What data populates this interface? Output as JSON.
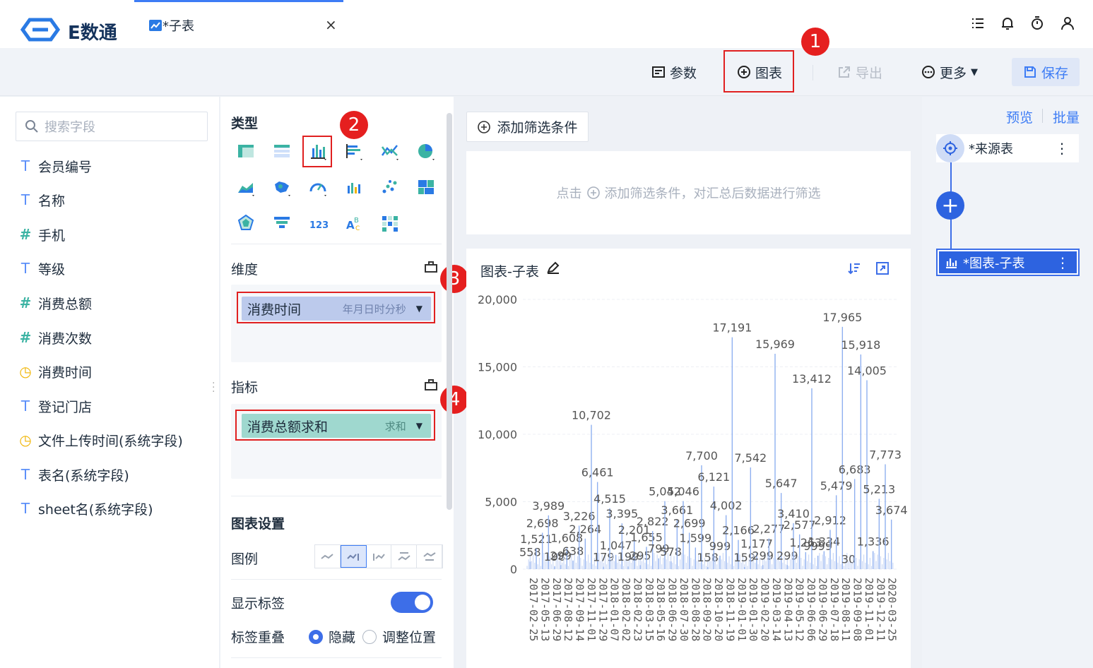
{
  "app": {
    "logo_text": "E数通"
  },
  "tab": {
    "title": "*子表",
    "close": "×"
  },
  "toolbar": {
    "params_label": "参数",
    "chart_label": "图表",
    "export_label": "导出",
    "more_label": "更多",
    "save_label": "保存"
  },
  "badges": [
    "1",
    "2",
    "3",
    "4"
  ],
  "search": {
    "placeholder": "搜索字段"
  },
  "fields": [
    {
      "type": "T",
      "label": "会员编号"
    },
    {
      "type": "T",
      "label": "名称"
    },
    {
      "type": "#",
      "label": "手机"
    },
    {
      "type": "T",
      "label": "等级"
    },
    {
      "type": "#",
      "label": "消费总额"
    },
    {
      "type": "#",
      "label": "消费次数"
    },
    {
      "type": "time",
      "label": "消费时间"
    },
    {
      "type": "T",
      "label": "登记门店"
    },
    {
      "type": "time",
      "label": "文件上传时间(系统字段)"
    },
    {
      "type": "T",
      "label": "表名(系统字段)"
    },
    {
      "type": "T",
      "label": "sheet名(系统字段)"
    }
  ],
  "config": {
    "type_title": "类型",
    "dimension_title": "维度",
    "dimension_pill": {
      "label": "消费时间",
      "sub": "年月日时分秒"
    },
    "metric_title": "指标",
    "metric_pill": {
      "label": "消费总额求和",
      "sub": "求和"
    },
    "chart_settings_title": "图表设置",
    "legend_label": "图例",
    "show_labels_label": "显示标签",
    "overlap_label": "标签重叠",
    "overlap_hide": "隐藏",
    "overlap_adjust": "调整位置"
  },
  "filter": {
    "add_label": "添加筛选条件",
    "hint_prefix": "点击",
    "hint_suffix": "添加筛选条件，对汇总后数据进行筛选"
  },
  "chart_card": {
    "title": "图表-子表"
  },
  "flow": {
    "preview": "预览",
    "batch": "批量",
    "source_node": "*来源表",
    "chart_node": "*图表-子表"
  },
  "colors": {
    "accent": "#3d6ee8",
    "bar": "#8fb0f0",
    "badge": "#e51f1f",
    "metric_pill": "#9fd8cf",
    "dimension_pill": "#bccaec"
  },
  "chart_data": {
    "type": "bar",
    "ylim": [
      0,
      20000
    ],
    "yticks": [
      "20,000",
      "15,000",
      "10,000",
      "5,000",
      "0"
    ],
    "xticks": [
      "2017-02-25",
      "2017-05-13",
      "2017-06-29",
      "2017-08-12",
      "2017-09-14",
      "2017-11-01",
      "2017-11-29",
      "2018-01-07",
      "2018-02-02",
      "2018-02-23",
      "2018-03-15",
      "2018-05-16",
      "2018-06-29",
      "2018-07-30",
      "2018-08-28",
      "2018-09-20",
      "2018-10-20",
      "2018-11-19",
      "2019-01-01",
      "2019-01-30",
      "2019-02-20",
      "2019-03-14",
      "2019-04-13",
      "2019-05-12",
      "2019-06-06",
      "2019-06-29",
      "2019-07-18",
      "2019-08-11",
      "2019-09-08",
      "2019-11-01",
      "2019-12-11",
      "2020-03-25"
    ],
    "labels": [
      "558",
      "1,521",
      "2,698",
      "3,989",
      "198",
      "299",
      "1,608",
      "638",
      "3,226",
      "2,264",
      "10,702",
      "6,461",
      "179",
      "4,515",
      "1,047",
      "3,395",
      "199",
      "2,201",
      "295",
      "1,655",
      "2,822",
      "799",
      "5,042",
      "578",
      "3,661",
      "5,046",
      "2,699",
      "1,599",
      "7,700",
      "158",
      "6,121",
      "999",
      "4,002",
      "17,191",
      "2,166",
      "159",
      "7,542",
      "1,177",
      "299",
      "2,277",
      "15,969",
      "5,647",
      "299",
      "3,410",
      "2,577",
      "1,263",
      "13,412",
      "9999",
      "1,334",
      "2,912",
      "5,479",
      "17,965",
      "30",
      "6,683",
      "15,918",
      "14,005",
      "1,336",
      "5,213",
      "7,773",
      "3,674"
    ],
    "peaks": [
      558,
      1521,
      2698,
      3989,
      198,
      299,
      1608,
      638,
      3226,
      2264,
      10702,
      6461,
      179,
      4515,
      1047,
      3395,
      199,
      2201,
      295,
      1655,
      2822,
      799,
      5042,
      578,
      3661,
      5046,
      2699,
      1599,
      7700,
      158,
      6121,
      999,
      4002,
      17191,
      2166,
      159,
      7542,
      1177,
      299,
      2277,
      15969,
      5647,
      299,
      3410,
      2577,
      1263,
      13412,
      999,
      1334,
      2912,
      5479,
      17965,
      30,
      6683,
      15918,
      14005,
      1336,
      5213,
      7773,
      3674
    ]
  }
}
